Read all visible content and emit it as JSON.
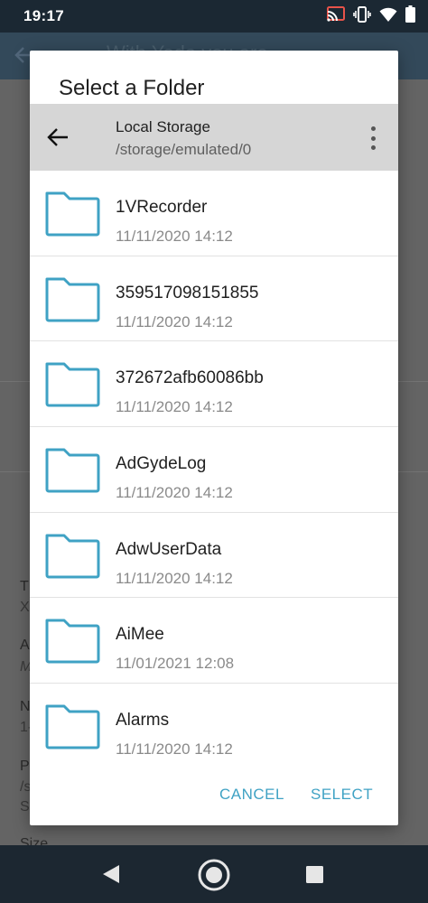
{
  "status_bar": {
    "time": "19:17",
    "icons": [
      "cast-icon",
      "vibrate-icon",
      "wifi-icon",
      "battery-icon"
    ]
  },
  "background_app": {
    "title": "With Yoda you are",
    "fragments": [
      "T",
      "X",
      "A",
      "M",
      "N",
      "1-",
      "P",
      "/s",
      "S",
      "Size"
    ]
  },
  "dialog": {
    "title": "Select a Folder",
    "location": {
      "name": "Local Storage",
      "path": "/storage/emulated/0"
    },
    "folders": [
      {
        "name": "1VRecorder",
        "date": "11/11/2020 14:12"
      },
      {
        "name": "359517098151855",
        "date": "11/11/2020 14:12"
      },
      {
        "name": "372672afb60086bb",
        "date": "11/11/2020 14:12"
      },
      {
        "name": "AdGydeLog",
        "date": "11/11/2020 14:12"
      },
      {
        "name": "AdwUserData",
        "date": "11/11/2020 14:12"
      },
      {
        "name": "AiMee",
        "date": "11/01/2021 12:08"
      },
      {
        "name": "Alarms",
        "date": "11/11/2020 14:12"
      }
    ],
    "actions": {
      "cancel": "CANCEL",
      "select": "SELECT"
    }
  },
  "colors": {
    "accent": "#3fa2c4",
    "folder_icon": "#3fa2c4",
    "path_bar": "#d6d6d6",
    "status_bar": "#1b2833",
    "nav_bar": "#1c2731"
  }
}
